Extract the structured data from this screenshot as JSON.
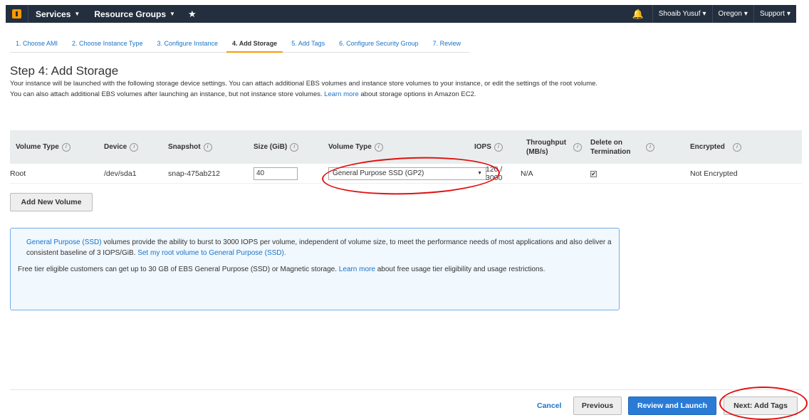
{
  "nav": {
    "logo_icon": "aws-cube-icon",
    "services": "Services",
    "resource_groups": "Resource Groups",
    "user": "Shoaib Yusuf",
    "region": "Oregon",
    "support": "Support"
  },
  "tabs": [
    {
      "label": "1. Choose AMI"
    },
    {
      "label": "2. Choose Instance Type"
    },
    {
      "label": "3. Configure Instance"
    },
    {
      "label": "4. Add Storage",
      "active": true
    },
    {
      "label": "5. Add Tags"
    },
    {
      "label": "6. Configure Security Group"
    },
    {
      "label": "7. Review"
    }
  ],
  "page": {
    "title": "Step 4: Add Storage",
    "desc_text": "Your instance will be launched with the following storage device settings. You can attach additional EBS volumes and instance store volumes to your instance, or edit the settings of the root volume. You can also attach additional EBS volumes after launching an instance, but not instance store volumes.",
    "desc_link": "Learn more",
    "desc_tail": "about storage options in Amazon EC2."
  },
  "table": {
    "headers": {
      "volume_type": "Volume Type",
      "device": "Device",
      "snapshot": "Snapshot",
      "size": "Size (GiB)",
      "volume_type2": "Volume Type",
      "iops": "IOPS",
      "throughput": "Throughput (MB/s)",
      "delete": "Delete on Termination",
      "encrypted": "Encrypted"
    },
    "row": {
      "volume_type": "Root",
      "device": "/dev/sda1",
      "snapshot": "snap-475ab212",
      "size": "40",
      "volume_type_select": "General Purpose SSD (GP2)",
      "iops": "120 / 3000",
      "throughput": "N/A",
      "delete_checked": true,
      "encrypted": "Not Encrypted"
    }
  },
  "add_volume_label": "Add New Volume",
  "infobox": {
    "p1_link": "General Purpose (SSD)",
    "p1_text": "volumes provide the ability to burst to 3000 IOPS per volume, independent of volume size, to meet the performance needs of most applications and also deliver a consistent baseline of 3 IOPS/GiB.",
    "p1_link2": "Set my root volume to General Purpose (SSD).",
    "p2_text": "Free tier eligible customers can get up to 30 GB of EBS General Purpose (SSD) or Magnetic storage.",
    "p2_link": "Learn more",
    "p2_tail": "about free usage tier eligibility and usage restrictions."
  },
  "footer": {
    "cancel": "Cancel",
    "previous": "Previous",
    "review": "Review and Launch",
    "next": "Next: Add Tags"
  },
  "colors": {
    "nav_bg": "#232f3e",
    "accent": "#f90",
    "link": "#1a73c8",
    "primary_button": "#2a7bd6",
    "annotation": "#e01010"
  }
}
